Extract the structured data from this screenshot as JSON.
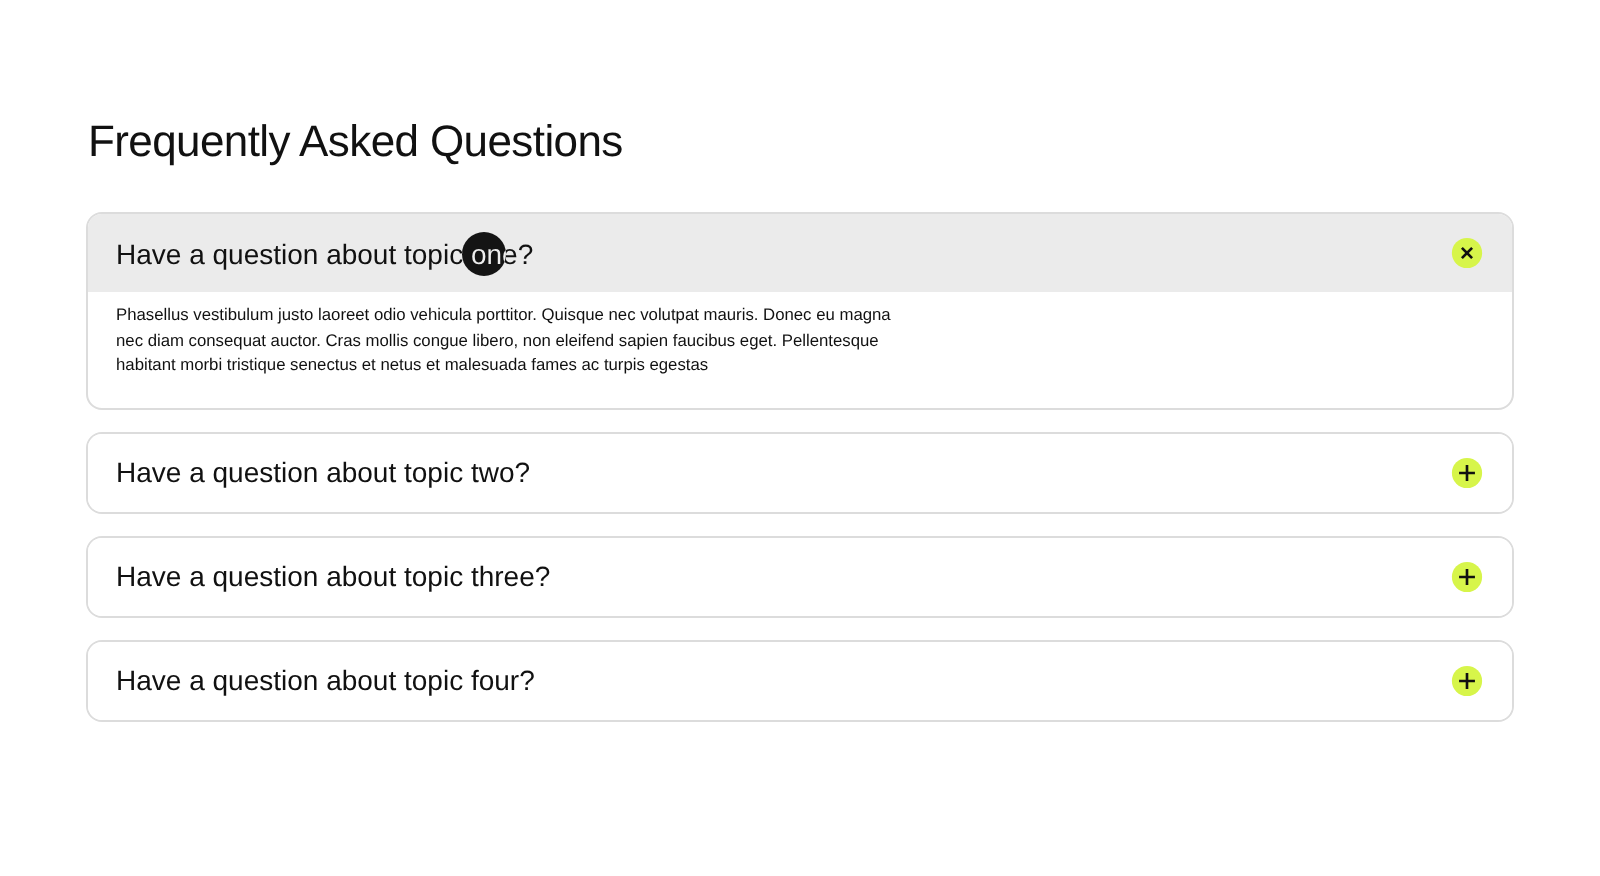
{
  "title": "Frequently Asked Questions",
  "items": [
    {
      "question": "Have a question about topic one?",
      "expanded": true,
      "answer": "Phasellus vestibulum justo laoreet odio vehicula porttitor. Quisque nec volutpat mauris. Donec eu magna nec diam consequat auctor. Cras mollis congue libero, non eleifend sapien faucibus eget. Pellentesque habitant morbi tristique senectus et netus et malesuada fames ac turpis egestas"
    },
    {
      "question": "Have a question about topic two?",
      "expanded": false
    },
    {
      "question": "Have a question about topic three?",
      "expanded": false
    },
    {
      "question": "Have a question about topic four?",
      "expanded": false
    }
  ]
}
